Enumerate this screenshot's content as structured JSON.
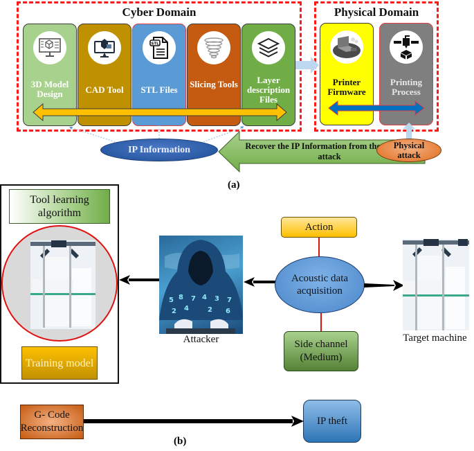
{
  "panel_a": {
    "caption": "(a)",
    "cyber_domain": {
      "title": "Cyber Domain",
      "stages": [
        {
          "label": "3D Model Design",
          "icon": "monitor-cube-icon",
          "color": "#a9d18e"
        },
        {
          "label": "CAD Tool",
          "icon": "cad-monitor-icon",
          "color": "#bf9000"
        },
        {
          "label": "STL Files",
          "icon": "stl-file-icon",
          "color": "#5b9bd5"
        },
        {
          "label": "Slicing Tools",
          "icon": "slicing-spiral-icon",
          "color": "#c55a11"
        },
        {
          "label": "Layer description Files",
          "icon": "layers-icon",
          "color": "#70ad47"
        }
      ],
      "flow_arrow_color": "#ffc000"
    },
    "physical_domain": {
      "title": "Physical Domain",
      "stages": [
        {
          "label": "Printer Firmware",
          "icon": "laptop-firmware-icon",
          "color": "#ffff00"
        },
        {
          "label": "Printing Process",
          "icon": "print-head-icon",
          "color": "#7f7f7f"
        }
      ],
      "flow_arrow_color": "#0070c0"
    },
    "ip_information": "IP Information",
    "recover_arrow": "Recover the IP Information from the Physical attack",
    "physical_attack": "Physical attack"
  },
  "panel_b": {
    "caption": "(b)",
    "tool_learning": "Tool learning algorithm",
    "training_model": "Training model",
    "attacker_label": "Attacker",
    "action": "Action",
    "acoustic": "Acoustic data acquisition",
    "side_channel": "Side channel (Medium)",
    "target_label": "Target machine",
    "gcode": "G- Code Reconstruction",
    "ip_theft": "IP theft"
  }
}
